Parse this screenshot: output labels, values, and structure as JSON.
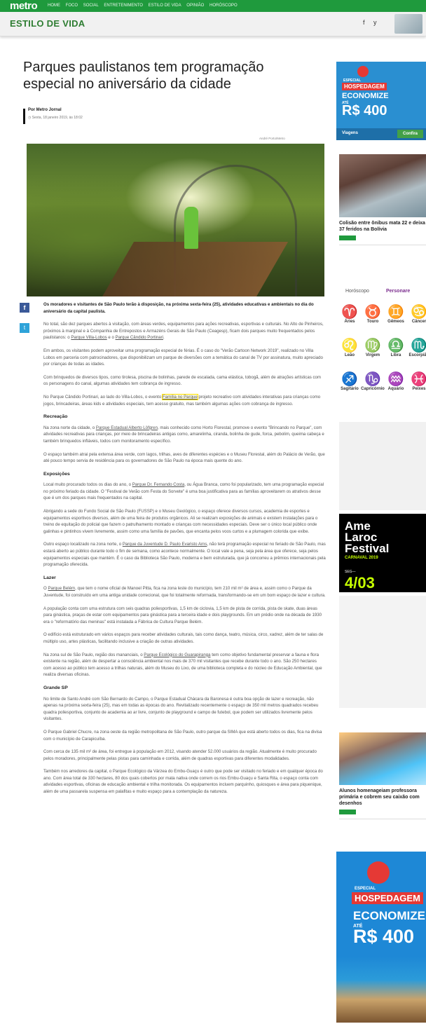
{
  "topbar": {
    "logo": "metro",
    "nav": [
      "HOME",
      "FOCO",
      "SOCIAL",
      "ENTRETENIMENTO",
      "ESTILO DE VIDA",
      "OPINIÃO",
      "HORÓSCOPO"
    ]
  },
  "section": {
    "title": "ESTILO DE VIDA",
    "share_icons": [
      "f",
      "y"
    ]
  },
  "article": {
    "headline": "Parques paulistanos tem programação especial no aniversário da cidade",
    "author": "Por Metro Jornal",
    "date": "Sexta, 18 janeiro 2019, às 18:02",
    "photo_credit": "André Porto/Metro",
    "share": {
      "facebook": "f",
      "twitter": "t"
    },
    "lead": "Os moradores e visitantes de São Paulo terão à disposição, na próxima sexta-feira (25), atividades educativas e ambientais no dia do aniversário da capital paulista.",
    "p1_a": "No total, são dez parques abertos à visitação, com áreas verdes, equipamentos para ações recreativas, esportivas e culturais. No Alto de Pinheiros, próximos à marginal e à Companhia de Entrepostos e Armazéns Gerais de São Paulo (Ceagesp), ficam dois parques muito frequentados pelos paulistanos: o ",
    "p1_link1": "Parque Villa-Lobos",
    "p1_b": " e o ",
    "p1_link2": "Parque Cândido Portinari",
    "p1_c": ".",
    "p2": "Em ambos, os visitantes podem aproveitar uma programação especial de férias. É o caso do \"Verão Cartoon Network 2019\", realizado no Villa Lobos em parceria com patrocinadores, que disponibilizam um parque de diversões com a temática do canal de TV por assinatura, muito apreciado por crianças de todas as idades.",
    "p3": "Com brinquedos de diversos tipos, como tirolesa, piscina de bolinhas, parede de escalada, cama elástica, tobogã, além de atrações artísticas com os personagens do canal, algumas atividades tem cobrança de ingresso.",
    "p4_a": "No Parque Cândido Portinari, ao lado do Villa-Lobos, o evento ",
    "p4_link": "Família no Parque",
    "p4_b": " projeto recreativo com atividades interativas para crianças como jogos, brincadeiras, áreas kids e atividades especiais, tem acesso gratuito, mas também algumas ações com cobrança de ingresso.",
    "h_recreacao": "Recreação",
    "p5_a": "Na zona norte da cidade, o ",
    "p5_link": "Parque Estadual Alberto Löfgren",
    "p5_b": ", mais conhecido como Horto Florestal, promove o evento \"Brincando no Parque\", com atividades recreativas para crianças, por meio de brincadeiras antigas como, amarelinha, ciranda, bolinha de gude, forca, pebolim, queima cabeça e também brinquedos infláveis, todos com monitoramento específico.",
    "p6": "O espaço também atrai pela extensa área verde, com lagos, trilhas, aves de diferentes espécies e o Museu Florestal, além do Palácio de Verão, que até pouco tempo servia de residência para os governadores de São Paulo na época mais quente do ano.",
    "h_exposicoes": "Exposições",
    "p7_a": "Local muito procurado todos os dias do ano, o ",
    "p7_link": "Parque Dr. Fernando Costa",
    "p7_b": ", ou Água Branca, como foi popularizado, tem uma programação especial no próximo feriado da cidade. O \"Festival de Verão com Festa do Sorvete\" é uma boa justificativa para as famílias aproveitarem os atrativos desse que é um dos parques mais frequentados na capital.",
    "p8": "Abrigando a sede do Fundo Social de São Paulo (FUSSP) e o Museu Geológico, o espaço oferece diversos cursos, academia de esportes e equipamentos esportivos diversos, além de uma feira de produtos orgânicos. Ali se realizam exposições de animais e existem instalações para o treino de equitação do policial que fazem o patrulhamento montado e crianças com necessidades especiais. Deve ser o único local público onde galinhas e pintinhos vivem livremente, assim como uma família de pavões, que encanta pelos voos curtos e a plumagem colorida que exibe.",
    "p9_a": "Outro espaço localizado na zona norte, o ",
    "p9_link": "Parque da Juventude D. Paulo Evaristo Arns",
    "p9_b": ", não terá programação especial no feriado de São Paulo, mas estará aberto ao público durante todo o fim de semana, como acontece normalmente. O local vale a pena, seja pela área que oferece, seja pelos equipamentos especiais que mantém. É o caso da Biblioteca São Paulo, moderna e bem estruturada, que já concorreu a prêmios internacionais pela programação oferecida.",
    "h_lazer": "Lazer",
    "p10_a": "O ",
    "p10_link": "Parque Belém",
    "p10_b": ", que tem o nome oficial de Manoel Pitta, fica na zona leste do município, tem 210 mil m² de área e, assim como o Parque da Juventude, foi construído em uma antiga unidade correcional, que foi totalmente reformada, transformando-se em um bom espaço de lazer e cultura.",
    "p11": "A população conta com uma estrutura com seis quadras poliesportivas, 1,5 km de ciclovia, 1,5 km de pista de corrida, pista de skate, duas áreas para ginástica, praças de estar com equipamentos para ginástica para a terceira idade e dois playgrounds. Em um prédio onde na década de 1930 era o \"reformatório das meninas\" está instalada a Fábrica de Cultura Parque Belém.",
    "p12": "O edifício está estruturado em vários espaços para receber atividades culturais, tais como dança, teatro, música, circo, xadrez, além de ter salas de múltiplo uso, artes plásticas, facilitando inclusive a criação de outras atividades.",
    "p13_a": "Na zona sul de São Paulo, região dos mananciais, o ",
    "p13_link": "Parque Ecológico do Guarapiranga",
    "p13_b": " tem como objetivo fundamental preservar a fauna e flora existente na região, além de despertar a consciência ambiental nos mais de 370 mil visitantes que recebe durante todo o ano. São 250 hectares com acesso ao público tem acesso a trilhas naturais, além do Museu do Lixo, de uma biblioteca completa e do núcleo de Educação Ambiental, que realiza diversas oficinas.",
    "h_grande_sp": "Grande SP",
    "p14": "No limite de Santo André com São Bernardo do Campo, o Parque Estadual Chácara da Baronesa é outra boa opção de lazer e recreação, não apenas na próxima sexta-feira (25), mas em todas as épocas do ano. Revitalizado recentemente o espaço de 350 mil metros quadrados recebeu quadra poliesportiva, conjunto de academia ao ar livre, conjunto de playground e campo de futebol, que podem ser utilizados livremente pelos visitantes.",
    "p15": "O Parque Gabriel Chucre, na zona oeste da região metropolitana de São Paulo, outro parque da SIMA que está aberto todos os dias, fica na divisa com o município de Carapicuíba.",
    "p16": "Com cerca de 135 mil m² de área, foi entregue à população em 2012, visando atender 52.000 usuários da região. Atualmente é muito procurado pelos moradores, principalmente pelas pistas para caminhada e corrida, além de quadras esportivas para diferentes modalidades.",
    "p17": "Também nos arredores da capital, o Parque Ecológico da Várzea do Embu-Guaçu é outro que pode ser visitado no feriado e em qualquer época do ano. Com área total de 330 hectares, 80 dos quais cobertos por mata nativa onde correm os rios Embu-Guaçu e Santa Rita, o espaço conta com atividades esportivas, oficinas de educação ambiental e trilha monitorada. Os equipamentos incluem parquinho, quiosques e área para piquenique, além de uma passarela suspensa em palafitas e muito espaço para a contemplação da natureza."
  },
  "sidebar": {
    "ad1": {
      "small": "ESPECIAL",
      "hosp": "HOSPEDAGEM",
      "econ": "ECONOMIZE",
      "ate": "ATÉ",
      "price": "R$ 400",
      "foot_left": "Viagens",
      "foot_btn": "Confira"
    },
    "card1": {
      "title": "Colisão entre ônibus mata 22 e deixa 37 feridos na Bolívia",
      "tag": "foco"
    },
    "horoscope": {
      "head": "Horóscopo",
      "brand": "Personare",
      "signs": [
        {
          "sym": "♈",
          "name": "Áries"
        },
        {
          "sym": "♉",
          "name": "Touro"
        },
        {
          "sym": "♊",
          "name": "Gêmeos"
        },
        {
          "sym": "♋",
          "name": "Câncer"
        },
        {
          "sym": "♌",
          "name": "Leão"
        },
        {
          "sym": "♍",
          "name": "Virgem"
        },
        {
          "sym": "♎",
          "name": "Libra"
        },
        {
          "sym": "♏",
          "name": "Escorpião"
        },
        {
          "sym": "♐",
          "name": "Sagitário"
        },
        {
          "sym": "♑",
          "name": "Capricórnio"
        },
        {
          "sym": "♒",
          "name": "Aquário"
        },
        {
          "sym": "♓",
          "name": "Peixes"
        }
      ],
      "colors": [
        "#c62828",
        "#2e7d32",
        "#f9a825",
        "#1e88e5"
      ]
    },
    "ad2": {
      "title_l1": "Ame",
      "title_l2": "Laroc",
      "title_l3": "Festival",
      "sub": "CARNAVAL 2019",
      "seg": "SEG—",
      "date": "4/03"
    },
    "card2": {
      "title": "Alunos homenageiam professora primária e cobrem seu caixão com desenhos",
      "tag": "foco"
    },
    "ad3": {
      "small": "ESPECIAL",
      "hosp": "HOSPEDAGEM",
      "econ": "ECONOMIZE",
      "ate": "ATÉ",
      "price": "R$ 400"
    }
  }
}
